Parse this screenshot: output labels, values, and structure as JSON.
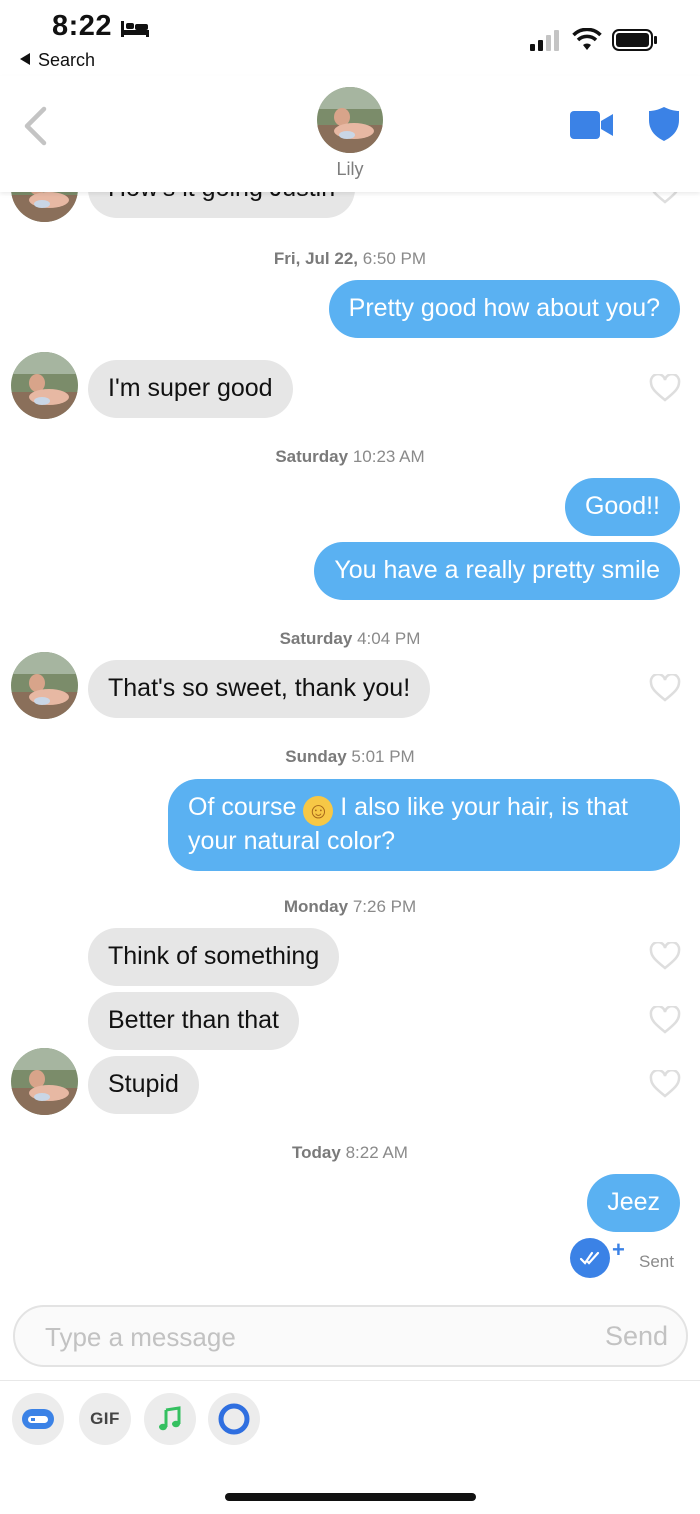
{
  "status_bar": {
    "time": "8:22",
    "back_app": "Search",
    "icons": [
      "bed-icon",
      "signal-icon",
      "wifi-icon",
      "battery-icon"
    ]
  },
  "header": {
    "name": "Lily",
    "icons": [
      "back-chevron-icon",
      "video-call-icon",
      "safety-shield-icon"
    ],
    "accent": "#3b82e6"
  },
  "messages": {
    "partial_top": "How's it going Justin",
    "ts1_day": "Fri, Jul 22,",
    "ts1_time": "6:50 PM",
    "m1": "Pretty good how about you?",
    "m2": "I'm super good",
    "ts2_day": "Saturday",
    "ts2_time": "10:23 AM",
    "m3": "Good!!",
    "m4": "You have a really pretty smile",
    "ts3_day": "Saturday",
    "ts3_time": "4:04 PM",
    "m5": "That's so sweet, thank you!",
    "ts4_day": "Sunday",
    "ts4_time": "5:01 PM",
    "m6_line1_a": "Of course",
    "m6_emoji": "☺",
    "m6_line1_b": "I also like your hair, is that",
    "m6_line2": "your natural color?",
    "ts5_day": "Monday",
    "ts5_time": "7:26 PM",
    "m7": "Think of something",
    "m8": "Better than that",
    "m9": "Stupid",
    "ts6_day": "Today",
    "ts6_time": "8:22 AM",
    "m10": "Jeez",
    "sent_status": "Sent",
    "plus": "+"
  },
  "colors": {
    "outgoing_bubble": "#5ab1f2",
    "incoming_bubble": "#e6e6e6"
  },
  "composer": {
    "placeholder": "Type a message",
    "send_label": "Send",
    "tools": [
      {
        "icon": "sticker-icon"
      },
      {
        "label": "GIF"
      },
      {
        "icon": "music-note-icon"
      },
      {
        "icon": "ring-icon"
      }
    ]
  }
}
